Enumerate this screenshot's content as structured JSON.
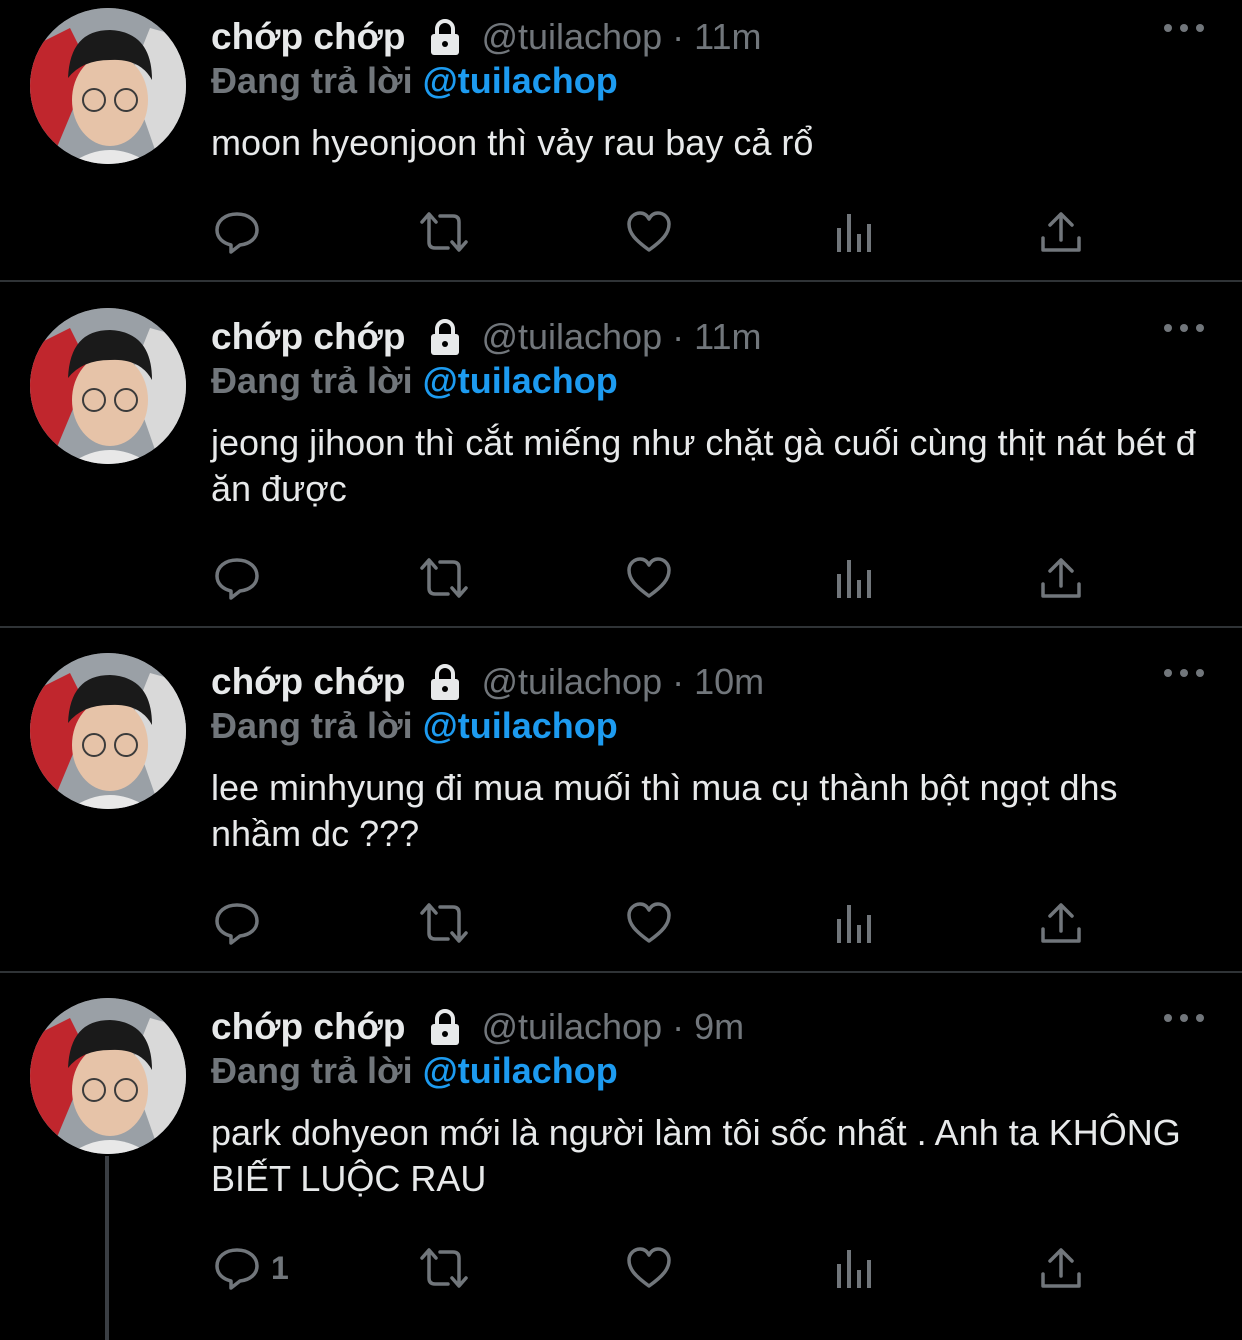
{
  "colors": {
    "background": "#000000",
    "primary_text": "#e7e9ea",
    "secondary_text": "#71767b",
    "accent": "#1d9bf0",
    "separator": "#2f3336"
  },
  "tweets": [
    {
      "display_name": "chớp chớp",
      "handle": "@tuilachop",
      "dot": "·",
      "time": "11m",
      "reply_prefix": "Đang trả lời",
      "reply_handle": "@tuilachop",
      "text": "moon hyeonjoon thì vảy rau bay cả rổ",
      "reply_count": ""
    },
    {
      "display_name": "chớp chớp",
      "handle": "@tuilachop",
      "dot": "·",
      "time": "11m",
      "reply_prefix": "Đang trả lời",
      "reply_handle": "@tuilachop",
      "text": "jeong jihoon thì cắt miếng như chặt gà cuối cùng thịt nát bét đ ăn được",
      "reply_count": ""
    },
    {
      "display_name": "chớp chớp",
      "handle": "@tuilachop",
      "dot": "·",
      "time": "10m",
      "reply_prefix": "Đang trả lời",
      "reply_handle": "@tuilachop",
      "text": "lee minhyung đi mua muối thì mua cụ thành bột ngọt dhs nhầm dc ???",
      "reply_count": ""
    },
    {
      "display_name": "chớp chớp",
      "handle": "@tuilachop",
      "dot": "·",
      "time": "9m",
      "reply_prefix": "Đang trả lời",
      "reply_handle": "@tuilachop",
      "text": "park dohyeon mới là người làm tôi sốc nhất . Anh ta KHÔNG BIẾT LUỘC RAU",
      "reply_count": "1"
    }
  ],
  "icons": {
    "lock": "lock-icon",
    "more": "more-icon",
    "reply": "reply-icon",
    "retweet": "retweet-icon",
    "like": "heart-icon",
    "views": "views-icon",
    "share": "share-icon"
  }
}
